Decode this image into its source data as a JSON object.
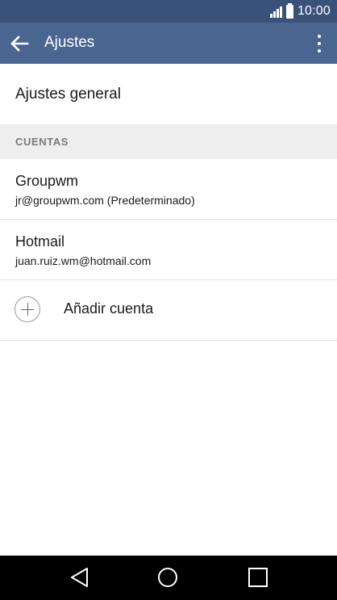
{
  "status_bar": {
    "time": "10:00",
    "signal_icon": "signal-icon",
    "battery_icon": "battery-icon"
  },
  "app_bar": {
    "title": "Ajustes",
    "back_icon": "arrow-left-icon",
    "menu_icon": "more-vert-icon",
    "background": "#4b6591",
    "status_background": "#3a527a"
  },
  "general": {
    "label": "Ajustes general"
  },
  "accounts_section": {
    "header": "CUENTAS",
    "accounts": [
      {
        "name": "Groupwm",
        "email": "jr@groupwm.com (Predeterminado)"
      },
      {
        "name": "Hotmail",
        "email": "juan.ruiz.wm@hotmail.com"
      }
    ],
    "add_account": {
      "label": "Añadir cuenta",
      "icon": "plus-circle-icon"
    }
  },
  "nav_bar": {
    "back_icon": "nav-back-icon",
    "home_icon": "nav-home-icon",
    "recents_icon": "nav-recents-icon"
  }
}
